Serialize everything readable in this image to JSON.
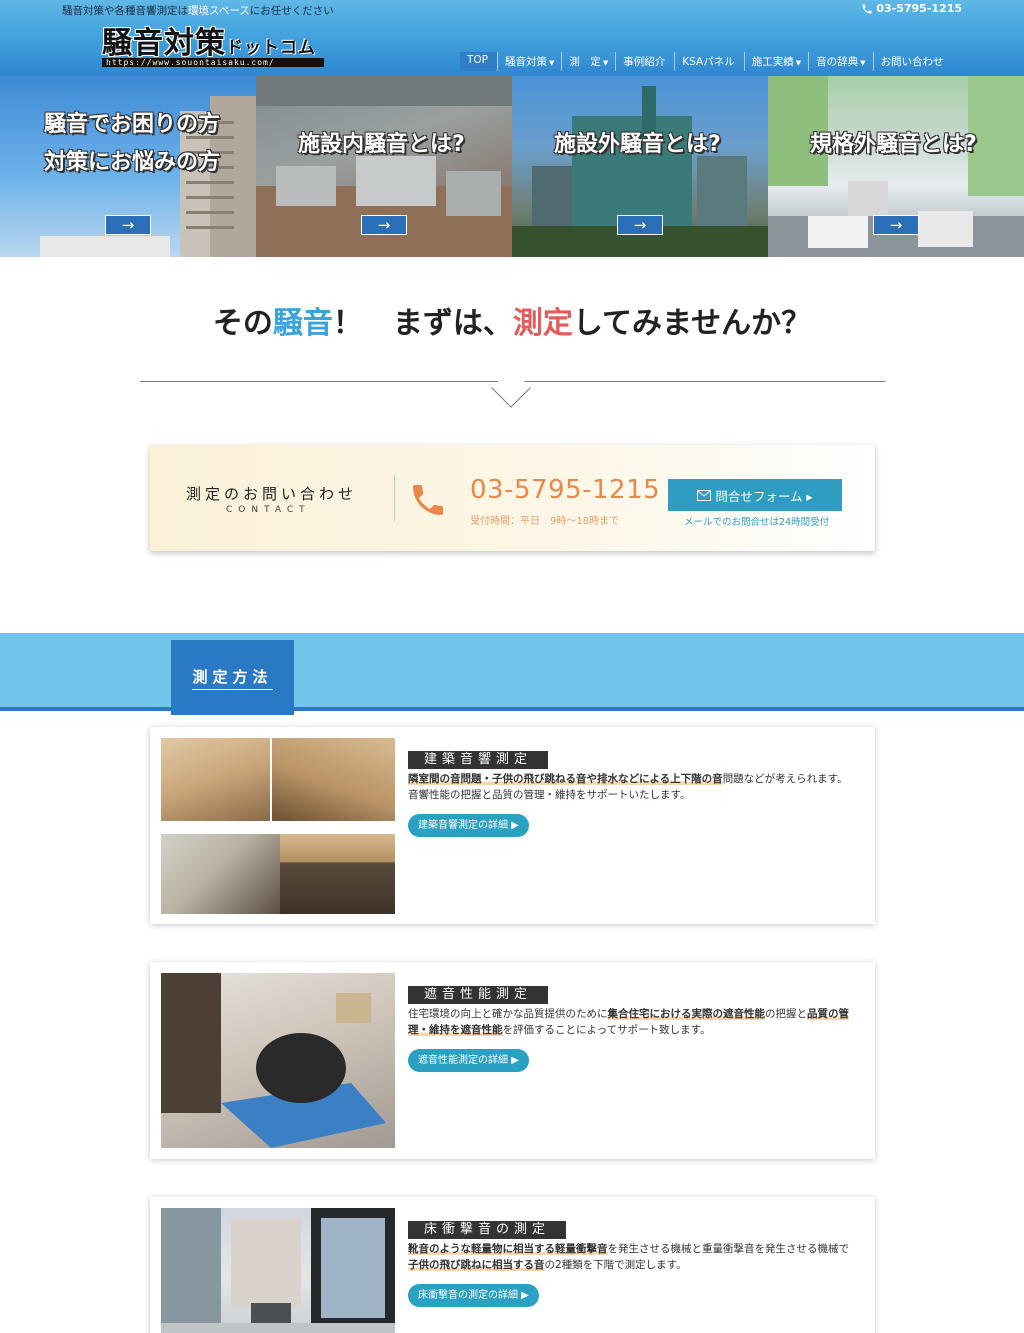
{
  "header": {
    "tagline_pre": "騒音対策や各種音響測定は",
    "tagline_highlight": "環境スペース",
    "tagline_post": "にお任せください",
    "phone": "03-5795-1215",
    "logo_main": "騒音対策",
    "logo_sub": "ドットコム",
    "logo_url": "https://www.souontaisaku.com/"
  },
  "nav": [
    {
      "label": "TOP",
      "caret": ""
    },
    {
      "label": "騒音対策",
      "caret": "▼"
    },
    {
      "label": "測　定",
      "caret": "▼"
    },
    {
      "label": "事例紹介",
      "caret": ""
    },
    {
      "label": "KSAパネル",
      "caret": ""
    },
    {
      "label": "施工実績",
      "caret": "▼"
    },
    {
      "label": "音の辞典",
      "caret": "▼"
    },
    {
      "label": "お問い合わせ",
      "caret": ""
    }
  ],
  "hero": [
    {
      "line1": "騒音でお困りの方",
      "line2": "対策にお悩みの方",
      "arrow": "→"
    },
    {
      "line1": "施設内騒音とは?",
      "line2": "",
      "arrow": "→"
    },
    {
      "line1": "施設外騒音とは?",
      "line2": "",
      "arrow": "→"
    },
    {
      "line1": "規格外騒音とは?",
      "line2": "",
      "arrow": "→"
    }
  ],
  "tagline": {
    "part1": "その",
    "part2": "騒音",
    "part3": "！　まずは、",
    "part4": "測定",
    "part5": "してみませんか？"
  },
  "contact": {
    "title": "測定のお問い合わせ",
    "subtitle": "CONTACT",
    "phone": "03-5795-1215",
    "hours": "受付時間：平日　9時〜18時まで",
    "form_button": "問合せフォーム ▸",
    "form_note": "メールでのお問合せは24時間受付"
  },
  "section": {
    "title": "測定方法"
  },
  "cards": [
    {
      "heading": "建築音響測定",
      "desc_b1": "隣室間の音問題・子供の飛び跳ねる音や排水などによる上下階の音",
      "desc_t1": "問題などが考えられます。",
      "desc_t2": "音響性能の把握と品質の管理・維持をサポートいたします。",
      "button": "建築音響測定の詳細 ▶"
    },
    {
      "heading": "遮音性能測定",
      "desc_t1": "住宅環境の向上と確かな品質提供のために",
      "desc_b1": "集合住宅における実際の遮音性能",
      "desc_t2": "の把握と",
      "desc_b2": "品質の管理・維持を遮音性能",
      "desc_t3": "を評価することによってサポート致します。",
      "button": "遮音性能測定の詳細 ▶"
    },
    {
      "heading": "床衝撃音の測定",
      "desc_b1": "靴音のような軽量物に相当する軽量衝撃音",
      "desc_t1": "を発生させる機械と重量衝撃音を発生させる機械で",
      "desc_b2": "子供の飛び跳ねに相当する音",
      "desc_t2": "の2種類を下階で測定します。",
      "button": "床衝撃音の測定の詳細 ▶"
    }
  ],
  "colors": {
    "header_blue": "#3f9fdc",
    "section_band": "#72c5ea",
    "section_tab": "#2a79c4",
    "accent_orange": "#e8884a",
    "button_teal": "#2aa0c2",
    "tagline_blue": "#3aa3da",
    "tagline_red": "#e45b5b"
  }
}
